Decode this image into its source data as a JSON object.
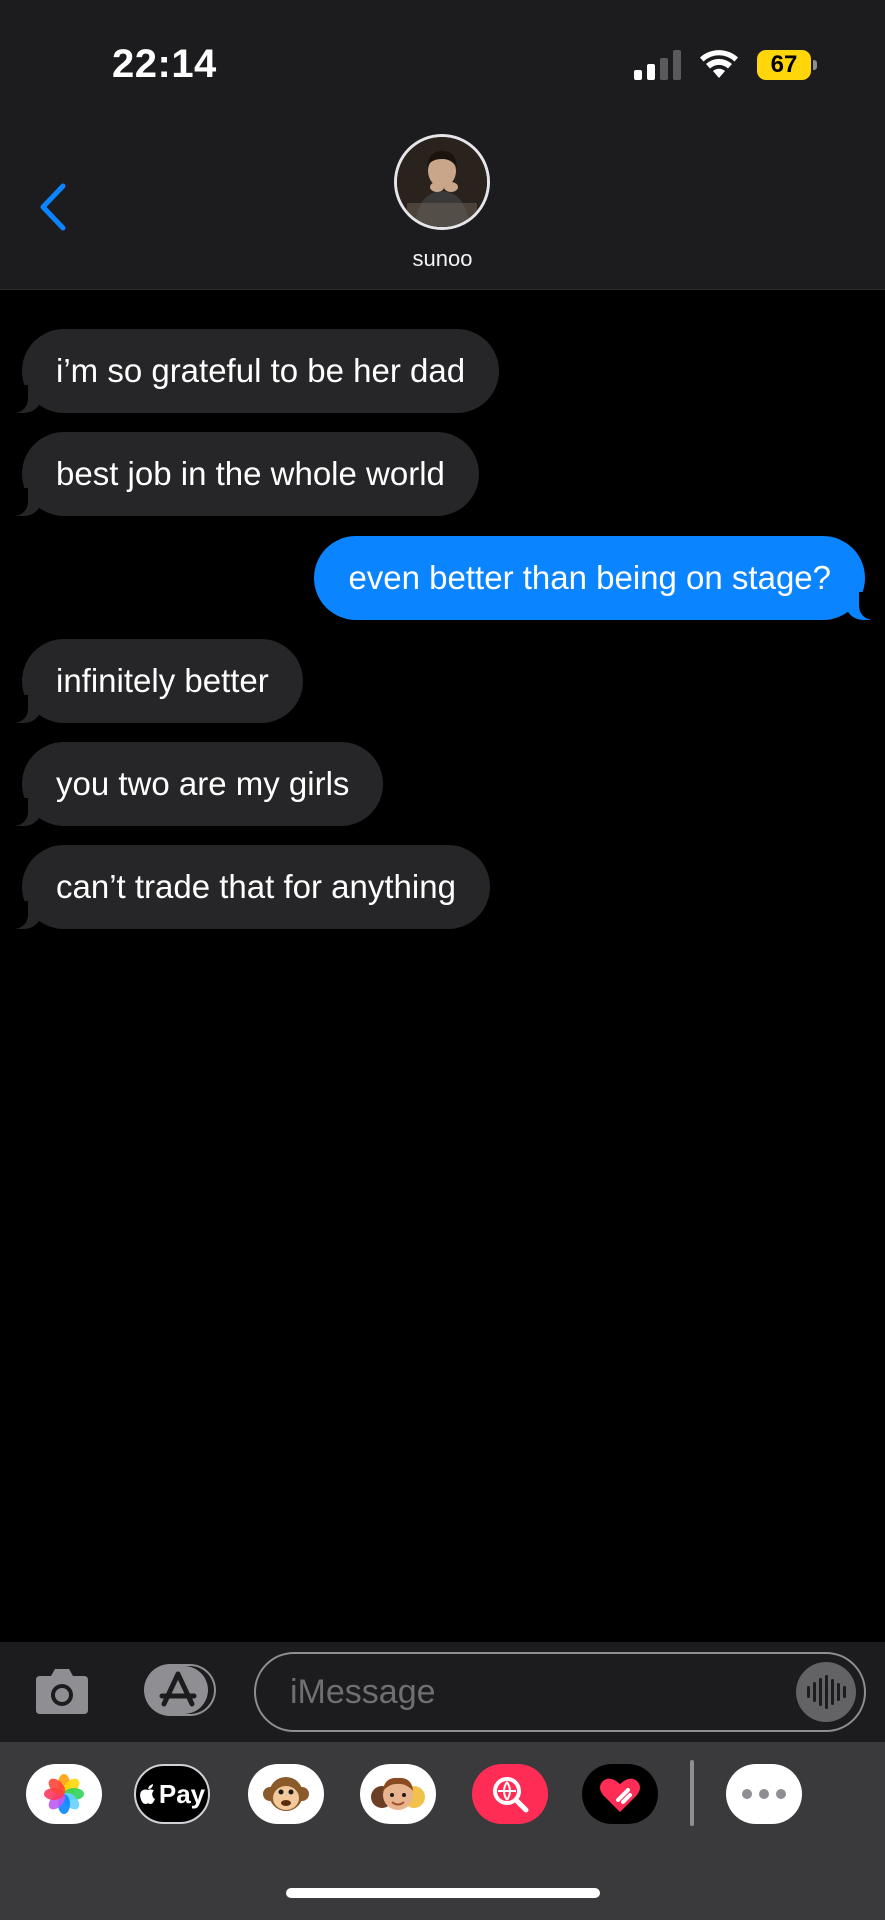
{
  "status_bar": {
    "time": "22:14",
    "battery": "67",
    "signal_bars_active": 2,
    "signal_bars_total": 4
  },
  "header": {
    "contact_name": "sunoo",
    "back_icon": "chevron-left-icon",
    "avatar": "contact-photo"
  },
  "messages": [
    {
      "direction": "in",
      "text": "i’m so grateful to be her dad"
    },
    {
      "direction": "in",
      "text": "best job in the whole world"
    },
    {
      "direction": "out",
      "text": "even better than being on stage?"
    },
    {
      "direction": "in",
      "text": "infinitely better"
    },
    {
      "direction": "in",
      "text": "you two are my girls"
    },
    {
      "direction": "in",
      "text": "can’t trade that for anything"
    }
  ],
  "input": {
    "placeholder": "iMessage",
    "camera_icon": "camera-icon",
    "apps_icon": "app-store-icon",
    "audio_icon": "waveform-icon"
  },
  "app_drawer": {
    "apps": [
      {
        "name": "Photos",
        "icon": "photos-icon"
      },
      {
        "name": "Pay",
        "icon": "apple-pay-icon"
      },
      {
        "name": "Animoji",
        "icon": "monkey-icon"
      },
      {
        "name": "Memoji",
        "icon": "memoji-icon"
      },
      {
        "name": "Images",
        "icon": "image-search-icon"
      },
      {
        "name": "Digital Touch",
        "icon": "heart-icon"
      },
      {
        "name": "More",
        "icon": "ellipsis-icon"
      }
    ],
    "pay_label": "Pay"
  },
  "colors": {
    "incoming_bubble": "#262628",
    "outgoing_bubble": "#0a84ff",
    "accent": "#0a84ff",
    "battery": "#ffd60a"
  }
}
